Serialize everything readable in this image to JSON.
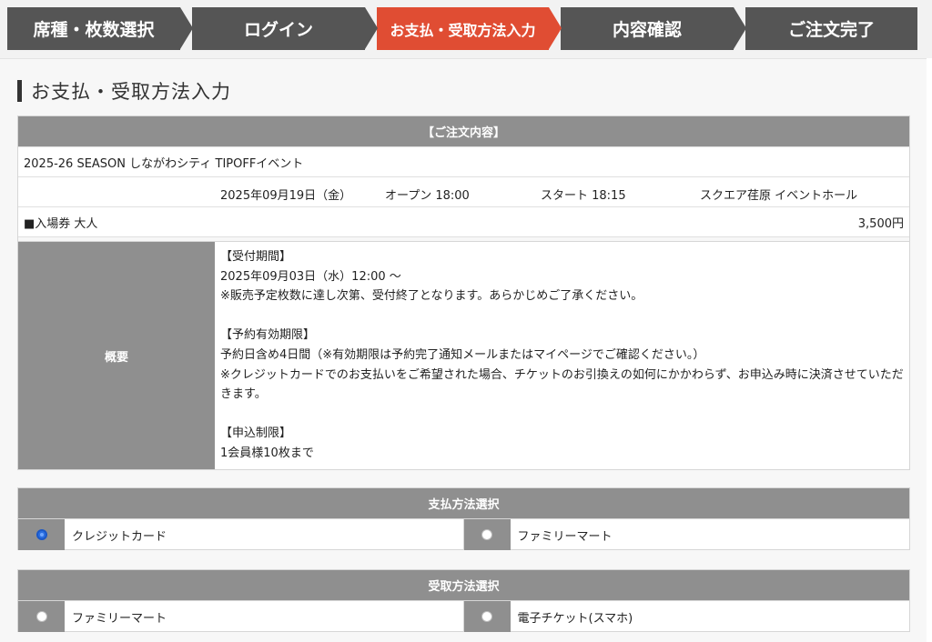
{
  "steps": [
    {
      "label": "席種・枚数選択",
      "current": false
    },
    {
      "label": "ログイン",
      "current": false
    },
    {
      "label": "お支払・受取方法入力",
      "current": true
    },
    {
      "label": "内容確認",
      "current": false
    },
    {
      "label": "ご注文完了",
      "current": false
    }
  ],
  "page_title": "お支払・受取方法入力",
  "order": {
    "header": "【ご注文内容】",
    "event_name": "2025-26 SEASON しながわシティ TIPOFFイベント",
    "date": "2025年09月19日（金）",
    "open": "オープン 18:00",
    "start": "スタート 18:15",
    "venue": "スクエア荏原 イベントホール",
    "ticket_type": "■入場券 大人",
    "price": "3,500円"
  },
  "summary": {
    "label": "概要",
    "lines": [
      "【受付期間】",
      "2025年09月03日（水）12:00 〜",
      "※販売予定枚数に達し次第、受付終了となります。あらかじめご了承ください。",
      "",
      "【予約有効期限】",
      "予約日含め4日間（※有効期限は予約完了通知メールまたはマイページでご確認ください。）",
      "※クレジットカードでのお支払いをご希望された場合、チケットのお引換えの如何にかかわらず、お申込み時に決済させていただきます。",
      "",
      "【申込制限】",
      "1会員様10枚まで"
    ]
  },
  "payment": {
    "header": "支払方法選択",
    "options": [
      {
        "label": "クレジットカード",
        "checked": true
      },
      {
        "label": "ファミリーマート",
        "checked": false
      }
    ]
  },
  "delivery": {
    "header": "受取方法選択",
    "options": [
      {
        "label": "ファミリーマート",
        "checked": false
      },
      {
        "label": "電子チケット(スマホ)",
        "checked": false
      }
    ]
  }
}
